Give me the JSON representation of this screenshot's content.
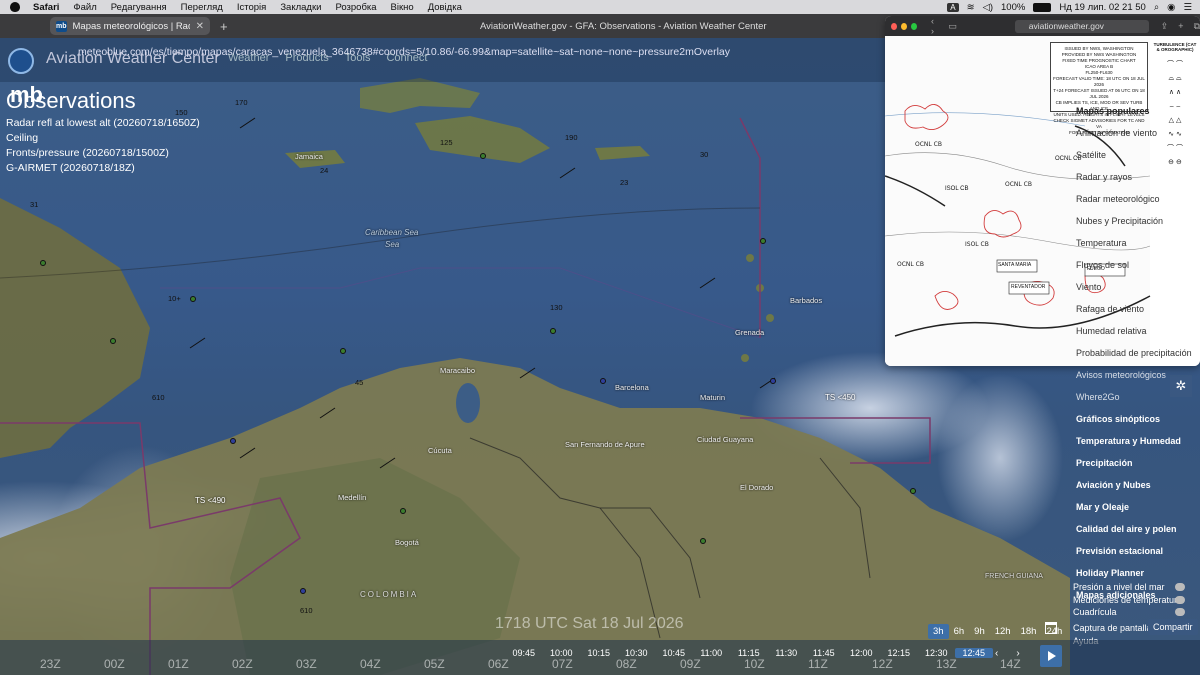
{
  "menubar": {
    "app": "Safari",
    "items": [
      "Файл",
      "Редагування",
      "Перегляд",
      "Історія",
      "Закладки",
      "Розробка",
      "Вікно",
      "Довідка"
    ],
    "battery": "100%",
    "input_lang": "A",
    "clock": "Нд 19 лип.  02 21 50"
  },
  "main_window": {
    "tab_label": "Mapas meteorológicos | Rada",
    "tab_favicon": "mb",
    "window_title": "AviationWeather.gov - GFA: Observations - Aviation Weather Center"
  },
  "overlay_url": "meteoblue.com/es/tiempo/mapas/caracas_venezuela_3646738#coords=5/10.86/-66.99&map=satellite~sat~none~none~pressure2mOverlay",
  "awc": {
    "title": "Aviation Weather Center",
    "nav": [
      "Weather",
      "Products",
      "Tools",
      "Connect"
    ],
    "mb_logo": "mb",
    "page_title": "Observations",
    "legend": [
      "Radar refl at lowest alt (20260718/1650Z)",
      "Ceiling",
      "Fronts/pressure (20260718/1500Z)",
      "G-AIRMET (20260718/18Z)"
    ]
  },
  "map_places": {
    "caribbean_sea": "Caribbean Sea",
    "sea": "Sea",
    "venezuela_cities": [
      "Maracaibo",
      "Barcelona",
      "Maturin",
      "Cúcuta",
      "Medellín",
      "Bogotá",
      "San Fernando de Apure",
      "Ciudad Guayana",
      "El Dorado"
    ],
    "islands": [
      "Jamaica",
      "Barbados",
      "Grenada"
    ],
    "colombia": "COLOMBIA",
    "french_guiana": "FRENCH GUIANA",
    "ts_labels": [
      "TS <450",
      "TS <490"
    ],
    "station_numbers": [
      "170",
      "150",
      "24",
      "31",
      "23",
      "10+",
      "610",
      "45",
      "610",
      "130",
      "125",
      "190",
      "30"
    ]
  },
  "win2": {
    "url": "aviationweather.gov",
    "chart_box_lines": [
      "ISSUED BY NWS, WASHINGTON",
      "PROVIDED BY NWS WASHINGTON",
      "FIXED TIME PROGNOSTIC CHART",
      "ICAO AREA B",
      "FL250-FL630",
      "FORECAST VALID TIME: 18 UTC ON 18 JUL 2026",
      "T+24 FORECAST ISSUED AT 06 UTC ON 18 JUL 2026",
      "CB IMPLIES TS, ICE, MOD OR SEV TURB AND ICE",
      "UNITS USED: HEIGHTS IN FLIGHT LEVELS",
      "CHECK SIGMET ADVISORIES FOR TC AND VA",
      "FOR LATEST INFORMATION"
    ],
    "legend_title": "TURBULENCE (CAT & OROGRAPHIC)",
    "labels": [
      "SANTA MARIA",
      "REVENTADOR",
      "FUEGO",
      "OCNL CB",
      "ISOL CB"
    ]
  },
  "side_menu": {
    "items": [
      {
        "label": "Mapas populares",
        "bold": true
      },
      {
        "label": "Animación de viento",
        "bold": false
      },
      {
        "label": "Satélite",
        "bold": false
      },
      {
        "label": "Radar y rayos",
        "bold": false
      },
      {
        "label": "Radar meteorológico",
        "bold": false
      },
      {
        "label": "Nubes y Precipitación",
        "bold": false
      },
      {
        "label": "Temperatura",
        "bold": false
      },
      {
        "label": "Fluyos de sol",
        "bold": false
      },
      {
        "label": "Viento",
        "bold": false
      },
      {
        "label": "Rafaga de viento",
        "bold": false
      },
      {
        "label": "Humedad relativa",
        "bold": false
      },
      {
        "label": "Probabilidad de precipitación",
        "bold": false
      },
      {
        "label": "Avisos meteorológicos",
        "bold": false
      },
      {
        "label": "Where2Go",
        "bold": false
      },
      {
        "label": "Gráficos sinópticos",
        "bold": true
      },
      {
        "label": "Temperatura y Humedad",
        "bold": true
      },
      {
        "label": "Precipitación",
        "bold": true
      },
      {
        "label": "Aviación y Nubes",
        "bold": true
      },
      {
        "label": "Mar y Oleaje",
        "bold": true
      },
      {
        "label": "Calidad del aire y polen",
        "bold": true
      },
      {
        "label": "Previsión estacional",
        "bold": true
      },
      {
        "label": "Holiday Planner",
        "bold": true
      },
      {
        "label": "Mapas adicionales",
        "bold": true
      }
    ],
    "toggles": [
      "Presión a nivel del mar",
      "Mediciones de temperatura",
      "Cuadrícula"
    ],
    "capture": "Captura de pantalla",
    "share": "Compartir",
    "help": "Ayuda"
  },
  "timeline": {
    "current_label": "1718 UTC Sat 18 Jul 2026",
    "ranges": [
      "3h",
      "6h",
      "9h",
      "12h",
      "18h",
      "24h"
    ],
    "selected_range": "3h",
    "ticks": [
      "09:45",
      "10:00",
      "10:15",
      "10:30",
      "10:45",
      "11:00",
      "11:15",
      "11:30",
      "11:45",
      "12:00",
      "12:15",
      "12:30",
      "12:45"
    ],
    "selected_tick": "12:45",
    "z_ticks": [
      "23Z",
      "00Z",
      "01Z",
      "02Z",
      "03Z",
      "04Z",
      "05Z",
      "06Z",
      "07Z",
      "08Z",
      "09Z",
      "10Z",
      "11Z",
      "12Z",
      "13Z",
      "14Z"
    ]
  },
  "colors": {
    "accent": "#3d6fa8",
    "land": "#8a8a5a",
    "sea": "#3a5a85"
  }
}
